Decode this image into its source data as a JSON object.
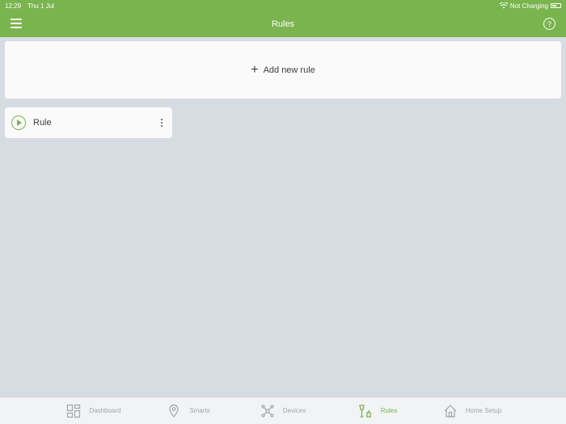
{
  "status_bar": {
    "time": "12:29",
    "date": "Thu 1 Jul",
    "charging": "Not Charging"
  },
  "header": {
    "title": "Rules",
    "help_label": "?"
  },
  "add_rule": {
    "plus": "+",
    "label": "Add new rule"
  },
  "rules": [
    {
      "name": "Rule"
    }
  ],
  "tabs": [
    {
      "label": "Dashboard",
      "icon": "dashboard-icon"
    },
    {
      "label": "Smarts",
      "icon": "smarts-icon"
    },
    {
      "label": "Devices",
      "icon": "devices-icon"
    },
    {
      "label": "Rules",
      "icon": "rules-icon",
      "active": true
    },
    {
      "label": "Home Setup",
      "icon": "home-icon"
    }
  ],
  "colors": {
    "accent": "#7ab44e",
    "background": "#d7dce3",
    "card": "#fafafa"
  }
}
